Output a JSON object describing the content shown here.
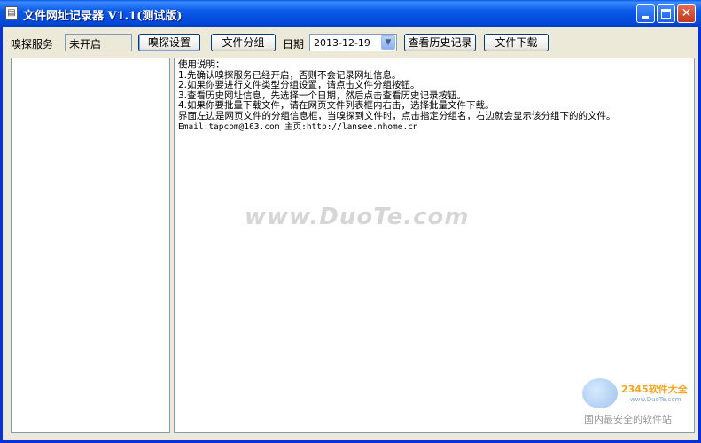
{
  "window": {
    "title": "文件网址记录器 V1.1(测试版)",
    "close_glyph": "✕",
    "app_icon": "▤"
  },
  "toolbar": {
    "service_label": "嗅探服务",
    "service_status": "未开启",
    "sniff_settings_button": "嗅探设置",
    "file_group_button": "文件分组",
    "date_label": "日期",
    "date_value": "2013-12-19",
    "dropdown_glyph": "▼",
    "view_history_button": "查看历史记录",
    "file_download_button": "文件下载"
  },
  "instructions": {
    "lines": [
      "使用说明：",
      "1.先确认嗅探服务已经开启，否则不会记录网址信息。",
      "2.如果你要进行文件类型分组设置，请点击文件分组按钮。",
      "3.查看历史网址信息，先选择一个日期，然后点击查看历史记录按钮。",
      "4.如果你要批量下载文件，请在网页文件列表框内右击，选择批量文件下载。",
      "界面左边是网页文件的分组信息框，当嗅探到文件时，点击指定分组名，右边就会显示该分组下的的文件。"
    ],
    "contact": "Email:tapcom@163.com 主页:http://lansee.nhome.cn"
  },
  "watermark": {
    "text": "www.DuoTe.com",
    "logo_brand": "2345软件大全",
    "logo_url": "www.DuoTe.com",
    "logo_slogan": "国内最安全的软件站"
  }
}
